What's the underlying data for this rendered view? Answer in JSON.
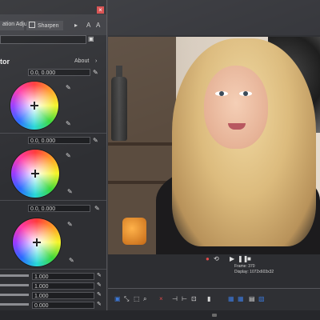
{
  "tabs": [
    {
      "label": "ation Adjust"
    },
    {
      "label": "Sharpen"
    }
  ],
  "panel": {
    "title": "tor",
    "about_label": "About",
    "about_chevron": "›"
  },
  "wheels": [
    {
      "value": "0.0, 0.000"
    },
    {
      "value": "0.0, 0.000"
    },
    {
      "value": "0.0, 0.000"
    }
  ],
  "sliders": [
    {
      "value": "1.000"
    },
    {
      "value": "1.000"
    },
    {
      "value": "1.000"
    },
    {
      "value": "0.000"
    }
  ],
  "transport": {
    "frame_label": "Frame:  370",
    "display_label": "Display:  1072x603x32"
  },
  "icons": {
    "eyedropper": "✎",
    "checkmark": "✓",
    "close": "×",
    "play": "▶",
    "pause": "❚❚",
    "stop": "■",
    "loop": "⟲",
    "record": "●"
  },
  "colors": {
    "panel_bg": "#2e2f33",
    "accent": "#3c78d8",
    "close_red": "#d84c4c"
  }
}
